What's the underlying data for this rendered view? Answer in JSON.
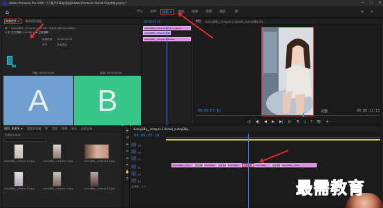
{
  "window": {
    "title": "Adobe Premiere Pro 2020 - C:\\用户\\Fiddy\\文档\\Adobe\\Premiere Pro\\14.0\\未命名.prproj *",
    "controls": [
      "—",
      "□",
      "✕"
    ]
  },
  "workspace": {
    "tabs": [
      "学习",
      "组件",
      "编辑",
      "颜色",
      "效果",
      "音频",
      "图形",
      "库"
    ],
    "active_index": 2,
    "active_label": "编辑 ≡"
  },
  "effect_panel": {
    "tabs": [
      "效果控件 ≡",
      "基本图形面板"
    ],
    "source_line": "源 ~ sunnyBBy__clmg.ev.1.0oreel.. 未命名 (源) sunnyBBy...",
    "row1": "◎ 形 交叉溶解 ◇ (1.00) ◎  ▶  立体溶解",
    "row2": "持续时间",
    "row2_value": "00:00:00:01",
    "row3": "对齐",
    "row3_value": "中心切入",
    "label_a": "开始: 00:00:00:00",
    "label_b": "结束: 00:00:00:00",
    "box_a": "A",
    "box_b": "B",
    "color_a": "#6f9ecf",
    "color_b": "#37c58a"
  },
  "source_timeline": {
    "timecode": "00:00:07:10",
    "clips": [
      "sunnyBBy__clmg.ev.1.0ref_p_ethng",
      "sunnyBBy__clmg.ev.1.0oreel..pn",
      "sunnyBBy__clmg.ev.1.0oreel"
    ]
  },
  "program_monitor": {
    "tab": "节目",
    "tab_path": "sunnyBBy_clmg.ev.1.0oreel_sunnyBBy.10...",
    "timecode_left": "00:00:07:10",
    "zoom_label": "完整",
    "timecode_right": "00:00:11:13",
    "transport": [
      "◁|",
      "◀|",
      "◀",
      "▶",
      "▶|",
      "|▷",
      "⎘",
      "⤓",
      "⤒",
      "📷",
      "+"
    ]
  },
  "project_panel": {
    "tabs": [
      "项目: 未命名 ≡",
      "媒体浏览器",
      "库",
      "信息",
      "效果",
      "标记",
      "历史记录"
    ],
    "path": "未命名.prproj",
    "items": [
      {
        "label": "sunnyBBy__clmg.ev.1.0.jpg  5:00"
      },
      {
        "label": "sunnyBBy__clmg.ev.1.0.jpg  5:00"
      },
      {
        "label": "sunnyBBy__clmg.ev.1.0.jpg  5:00"
      },
      {
        "label": "sunnyBBy__clmg.ev.1.0.jpg  5:00"
      },
      {
        "label": "sunnyBBy__clmg.ev.1.0.jpg  5:00"
      },
      {
        "label": "sunnyBBy__clmg.ev.1.0.jpg  5:00"
      }
    ]
  },
  "timeline": {
    "tab": "sunnyBBy__clmg.ev.1.0oreel_sunnyBBy...",
    "timecode": "00:00:07:10",
    "tracks": [
      {
        "name": "V3"
      },
      {
        "name": "V2"
      },
      {
        "name": "V1"
      },
      {
        "name": "A1"
      },
      {
        "name": "A2"
      },
      {
        "name": "A3"
      }
    ],
    "master_label": "主声道",
    "master_value": "0.0",
    "clips": [
      "sunnyBBy__clmg",
      "交叉溶解",
      "sunnyBBy",
      "交叉溶解",
      "sunnyBBy",
      "立体溶解",
      "sunnyBBy",
      "交叉溶解",
      "sunnyBBy__clmg"
    ]
  },
  "watermark": {
    "text": "最需教育"
  }
}
